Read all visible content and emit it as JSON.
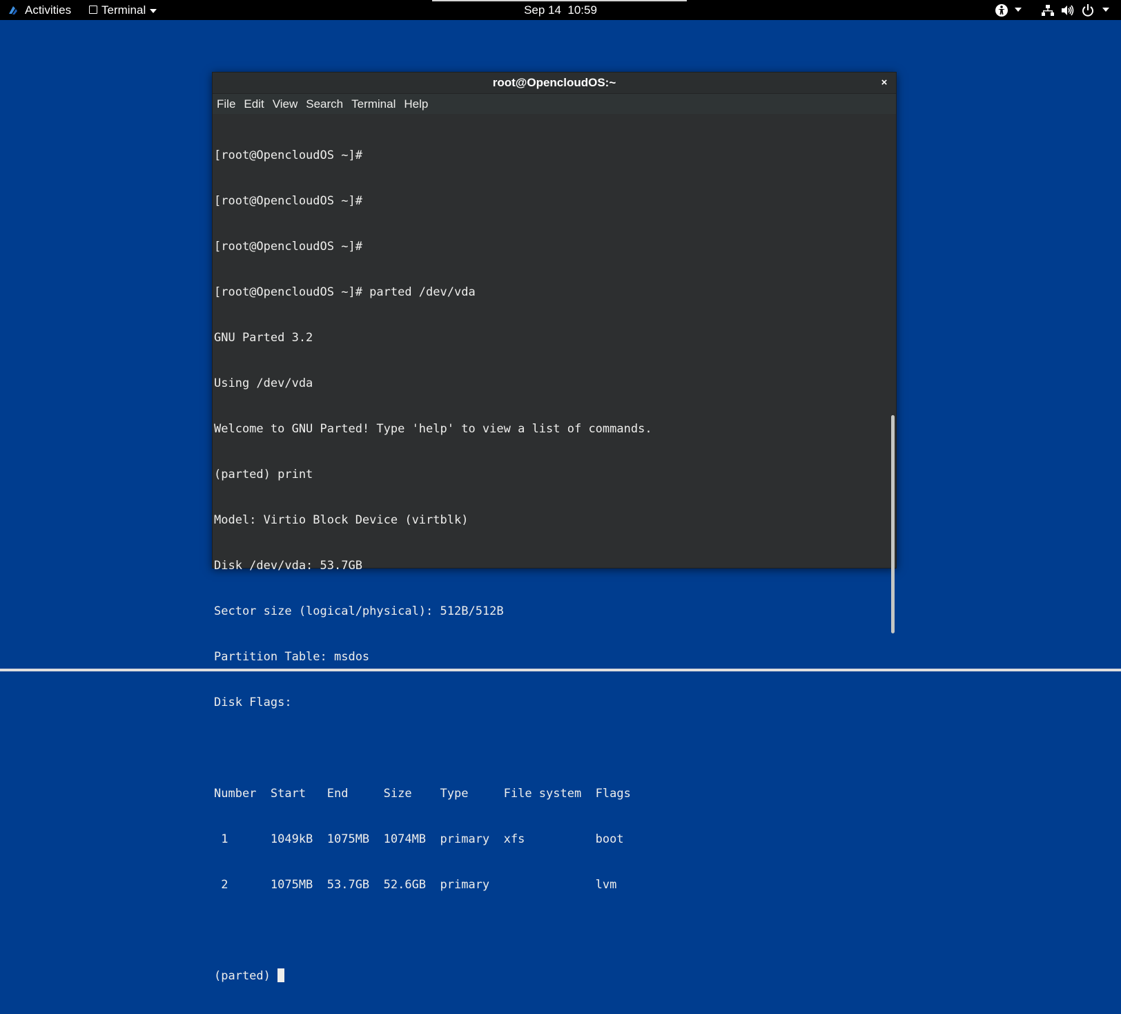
{
  "topbar": {
    "activities_label": "Activities",
    "app_label": "Terminal",
    "clock": "Sep 14  10:59"
  },
  "window": {
    "title": "root@OpencloudOS:~",
    "close_glyph": "×",
    "menu": [
      "File",
      "Edit",
      "View",
      "Search",
      "Terminal",
      "Help"
    ]
  },
  "terminal": {
    "lines": [
      "[root@OpencloudOS ~]#",
      "[root@OpencloudOS ~]#",
      "[root@OpencloudOS ~]#",
      "[root@OpencloudOS ~]# parted /dev/vda",
      "GNU Parted 3.2",
      "Using /dev/vda",
      "Welcome to GNU Parted! Type 'help' to view a list of commands.",
      "(parted) print",
      "Model: Virtio Block Device (virtblk)",
      "Disk /dev/vda: 53.7GB",
      "Sector size (logical/physical): 512B/512B",
      "Partition Table: msdos",
      "Disk Flags:",
      "",
      "Number  Start   End     Size    Type     File system  Flags",
      " 1      1049kB  1075MB  1074MB  primary  xfs          boot",
      " 2      1075MB  53.7GB  52.6GB  primary               lvm",
      ""
    ],
    "prompt": "(parted) "
  },
  "icons": {
    "activities": "activities-logo-icon",
    "app": "terminal-app-icon",
    "accessibility": "accessibility-icon",
    "network": "network-icon",
    "volume": "volume-icon",
    "power": "power-icon"
  }
}
